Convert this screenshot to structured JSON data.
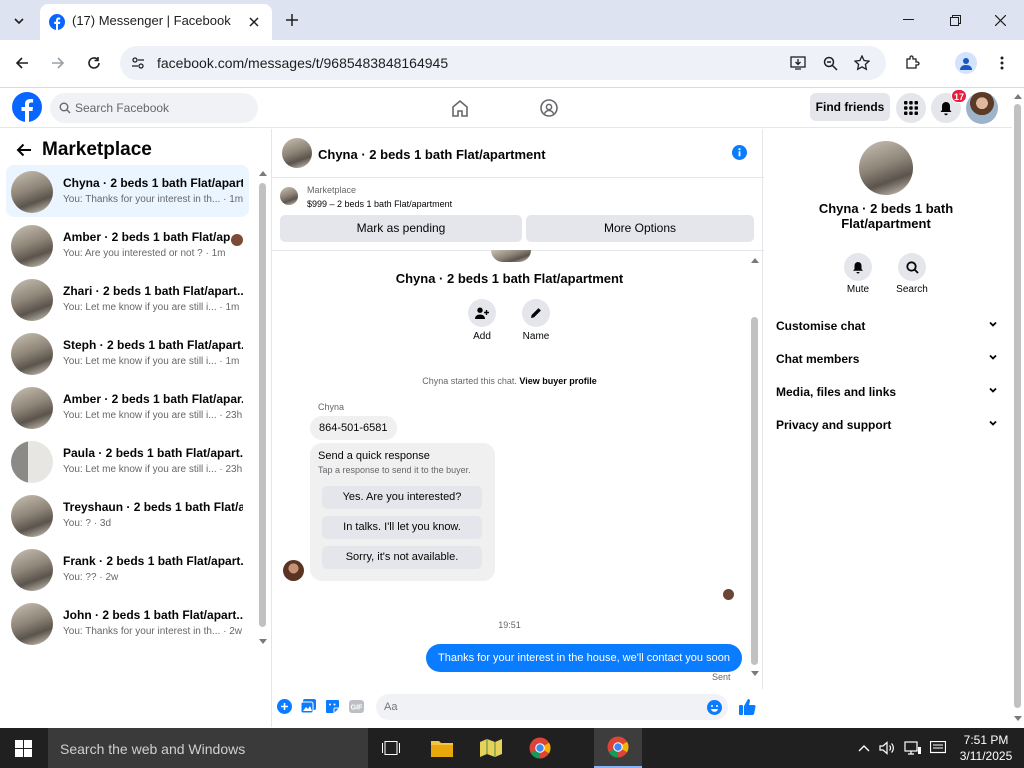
{
  "browser": {
    "tab_title": "(17) Messenger | Facebook",
    "url": "facebook.com/messages/t/9685483848164945"
  },
  "fb_header": {
    "search_placeholder": "Search Facebook",
    "find_friends": "Find friends",
    "notifications_count": "17"
  },
  "left_panel": {
    "title": "Marketplace",
    "conversations": [
      {
        "name": "Chyna · 2 beds 1 bath Flat/apart...",
        "preview": "You: Thanks for your interest in th... · 1m"
      },
      {
        "name": "Amber · 2 beds 1 bath Flat/ap...",
        "preview": "You: Are you interested or not ? · 1m"
      },
      {
        "name": "Zhari · 2 beds 1 bath Flat/apart...",
        "preview": "You: Let me know if you are still i... · 1m"
      },
      {
        "name": "Steph · 2 beds 1 bath Flat/apart...",
        "preview": "You: Let me know if you are still i... · 1m"
      },
      {
        "name": "Amber · 2 beds 1 bath Flat/apar...",
        "preview": "You: Let me know if you are still i... · 23h"
      },
      {
        "name": "Paula · 2 beds 1 bath Flat/apart...",
        "preview": "You: Let me know if you are still i... · 23h"
      },
      {
        "name": "Treyshaun · 2 beds 1 bath Flat/a...",
        "preview": "You: ? · 3d"
      },
      {
        "name": "Frank · 2 beds 1 bath Flat/apart...",
        "preview": "You: ?? · 2w"
      },
      {
        "name": "John · 2 beds 1 bath Flat/apart...",
        "preview": "You: Thanks for your interest in th... · 2w"
      }
    ]
  },
  "chat": {
    "header_name": "Chyna · 2 beds 1 bath Flat/apartment",
    "marketplace_label": "Marketplace",
    "listing": "$999 – 2 beds 1 bath Flat/apartment",
    "mark_pending": "Mark as pending",
    "more_options": "More Options",
    "profile_name": "Chyna · 2 beds 1 bath Flat/apartment",
    "add_label": "Add",
    "name_label": "Name",
    "started_text": "Chyna started this chat.",
    "view_buyer_profile": "View buyer profile",
    "sender_name": "Chyna",
    "phone_message": "864-501-6581",
    "quick_response_title": "Send a quick response",
    "quick_response_sub": "Tap a response to send it to the buyer.",
    "quick_responses": [
      "Yes. Are you interested?",
      "In talks. I'll let you know.",
      "Sorry, it's not available."
    ],
    "timestamp": "19:51",
    "sent_message": "Thanks for your interest in the house, we'll contact you soon",
    "sent_status": "Sent",
    "composer_placeholder": "Aa"
  },
  "right_panel": {
    "name": "Chyna · 2 beds 1 bath Flat/apartment",
    "mute": "Mute",
    "search": "Search",
    "sections": [
      "Customise chat",
      "Chat members",
      "Media, files and links",
      "Privacy and support"
    ]
  },
  "taskbar": {
    "search_placeholder": "Search the web and Windows",
    "time": "7:51 PM",
    "date": "3/11/2025"
  },
  "colors": {
    "fb_blue": "#0866ff",
    "messenger_blue": "#0a7cff",
    "active_conv": "#ebf5ff"
  }
}
